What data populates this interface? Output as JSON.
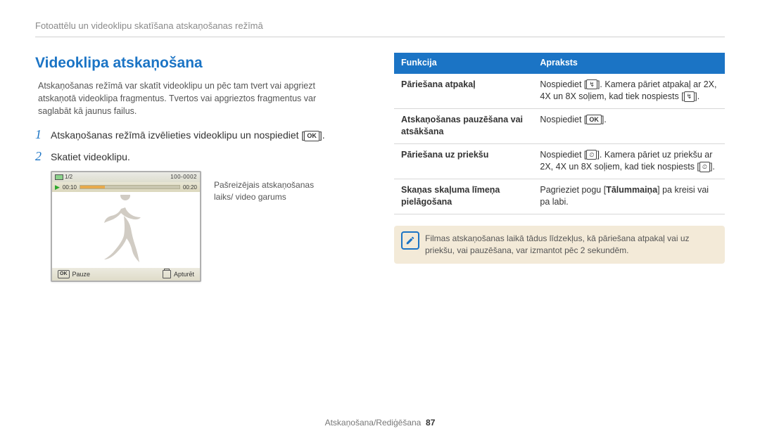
{
  "breadcrumb": "Fotoattēlu un videoklipu skatīšana atskaņošanas režīmā",
  "left": {
    "title": "Videoklipa atskaņošana",
    "intro": "Atskaņošanas režīmā var skatīt videoklipu un pēc tam tvert vai apgriezt atskaņotā videoklipa fragmentus. Tvertos vai apgrieztos fragmentus var saglabāt kā jaunus failus.",
    "steps": [
      {
        "num": "1",
        "text_before": "Atskaņošanas režīmā izvēlieties videoklipu un nospiediet [",
        "text_after": "]."
      },
      {
        "num": "2",
        "text_before": "Skatiet videoklipu.",
        "text_after": ""
      }
    ],
    "video": {
      "counter": "1/2",
      "filecode": "100-0002",
      "time_current": "00:10",
      "time_total": "00:20",
      "btn_pause": "Pauze",
      "btn_stop": "Apturēt"
    },
    "callout": "Pašreizējais atskaņošanas laiks/ video garums"
  },
  "right": {
    "table": {
      "head": {
        "col1": "Funkcija",
        "col2": "Apraksts"
      },
      "rows": [
        {
          "fn": "Pāriešana atpakaļ",
          "desc_pre": "Nospiediet [",
          "glyph1": "↯",
          "desc_mid": "]. Kamera pāriet atpakaļ ar 2X, 4X un 8X soļiem, kad tiek nospiests [",
          "glyph2": "↯",
          "desc_post": "]."
        },
        {
          "fn": "Atskaņošanas pauzēšana vai atsākšana",
          "desc_pre": "Nospiediet [",
          "glyph1": "OK",
          "desc_mid": "",
          "glyph2": "",
          "desc_post": "]."
        },
        {
          "fn": "Pāriešana uz priekšu",
          "desc_pre": "Nospiediet [",
          "glyph1": "⏲",
          "desc_mid": "]. Kamera pāriet uz priekšu ar 2X, 4X un 8X soļiem, kad tiek nospiests [",
          "glyph2": "⏲",
          "desc_post": "]."
        },
        {
          "fn": "Skaņas skaļuma līmeņa pielāgošana",
          "desc_pre": "Pagrieziet pogu [",
          "bold": "Tālummaiņa",
          "desc_post": "] pa kreisi vai pa labi."
        }
      ]
    },
    "note": "Filmas atskaņošanas laikā tādus līdzekļus, kā pāriešana atpakaļ vai uz priekšu, vai pauzēšana, var izmantot pēc 2 sekundēm."
  },
  "footer": {
    "section": "Atskaņošana/Rediģēšana",
    "page": "87"
  }
}
